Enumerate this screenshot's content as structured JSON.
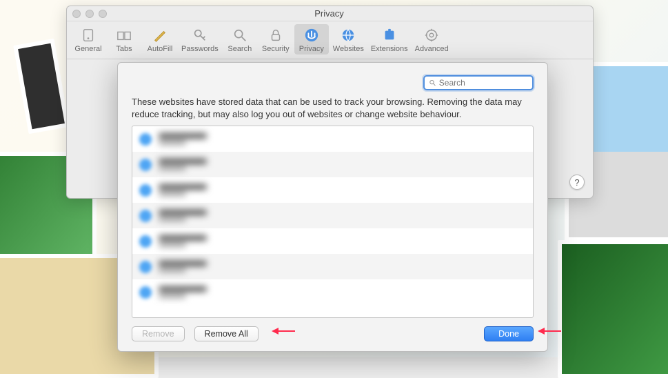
{
  "window": {
    "title": "Privacy"
  },
  "toolbar": {
    "items": [
      {
        "label": "General"
      },
      {
        "label": "Tabs"
      },
      {
        "label": "AutoFill"
      },
      {
        "label": "Passwords"
      },
      {
        "label": "Search"
      },
      {
        "label": "Security"
      },
      {
        "label": "Privacy"
      },
      {
        "label": "Websites"
      },
      {
        "label": "Extensions"
      },
      {
        "label": "Advanced"
      }
    ],
    "active_index": 6
  },
  "help_button": {
    "label": "?"
  },
  "sheet": {
    "search": {
      "placeholder": "Search",
      "value": ""
    },
    "description": "These websites have stored data that can be used to track your browsing. Removing the data may reduce tracking, but may also log you out of websites or change website behaviour.",
    "rows_count": 7,
    "buttons": {
      "remove": "Remove",
      "remove_all": "Remove All",
      "done": "Done"
    },
    "remove_enabled": false
  },
  "colors": {
    "accent": "#2f7ff2",
    "focus_ring": "#4f8ede"
  }
}
